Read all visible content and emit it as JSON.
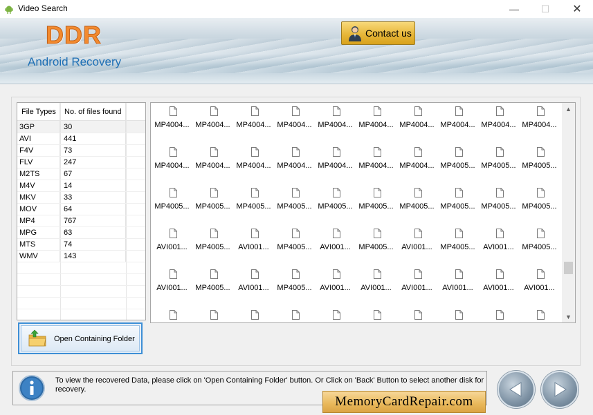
{
  "window": {
    "title": "Video Search",
    "minimize": "—",
    "maximize": "☐",
    "close": "✕"
  },
  "banner": {
    "logo": "DDR",
    "subtitle": "Android Recovery",
    "contact_label": "Contact us"
  },
  "file_types": {
    "headers": [
      "File Types",
      "No. of files found"
    ],
    "rows": [
      {
        "type": "3GP",
        "count": "30"
      },
      {
        "type": "AVI",
        "count": "441"
      },
      {
        "type": "F4V",
        "count": "73"
      },
      {
        "type": "FLV",
        "count": "247"
      },
      {
        "type": "M2TS",
        "count": "67"
      },
      {
        "type": "M4V",
        "count": "14"
      },
      {
        "type": "MKV",
        "count": "33"
      },
      {
        "type": "MOV",
        "count": "64"
      },
      {
        "type": "MP4",
        "count": "767"
      },
      {
        "type": "MPG",
        "count": "63"
      },
      {
        "type": "MTS",
        "count": "74"
      },
      {
        "type": "WMV",
        "count": "143"
      }
    ]
  },
  "open_folder_label": "Open Containing Folder",
  "files": {
    "rows": [
      [
        "MP4004...",
        "MP4004...",
        "MP4004...",
        "MP4004...",
        "MP4004...",
        "MP4004...",
        "MP4004...",
        "MP4004...",
        "MP4004...",
        "MP4004..."
      ],
      [
        "MP4004...",
        "MP4004...",
        "MP4004...",
        "MP4004...",
        "MP4004...",
        "MP4004...",
        "MP4004...",
        "MP4005...",
        "MP4005...",
        "MP4005..."
      ],
      [
        "MP4005...",
        "MP4005...",
        "MP4005...",
        "MP4005...",
        "MP4005...",
        "MP4005...",
        "MP4005...",
        "MP4005...",
        "MP4005...",
        "MP4005..."
      ],
      [
        "AVI001...",
        "MP4005...",
        "AVI001...",
        "MP4005...",
        "AVI001...",
        "MP4005...",
        "AVI001...",
        "MP4005...",
        "AVI001...",
        "MP4005..."
      ],
      [
        "AVI001...",
        "MP4005...",
        "AVI001...",
        "MP4005...",
        "AVI001...",
        "AVI001...",
        "AVI001...",
        "AVI001...",
        "AVI001...",
        "AVI001..."
      ],
      [
        "",
        "",
        "",
        "",
        "",
        "",
        "",
        "",
        "",
        ""
      ]
    ]
  },
  "info": {
    "text": "To view the recovered Data, please click on 'Open Containing Folder' button. Or Click on 'Back' Button to select another disk for recovery.",
    "brand": "MemoryCardRepair.com"
  },
  "colors": {
    "logo": "#f38a2e",
    "subtitle": "#1e6fb5",
    "accent_button": "#e7b73a",
    "selection_border": "#3d8fd6"
  }
}
